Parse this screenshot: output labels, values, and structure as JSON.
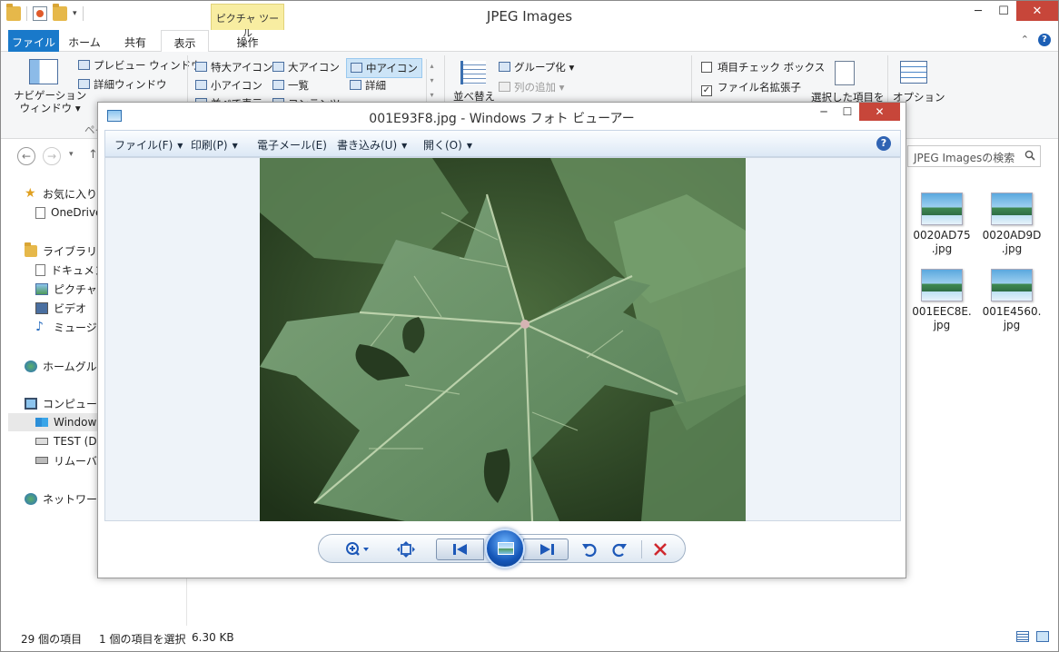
{
  "explorer": {
    "title": "JPEG Images",
    "context_tab_header": "ピクチャ ツール",
    "tabs": [
      "ファイル",
      "ホーム",
      "共有",
      "表示",
      "操作"
    ],
    "ribbon": {
      "nav_pane": "ナビゲーション\nウィンドウ ▾",
      "preview_pane": "プレビュー ウィンドウ",
      "details_pane": "詳細ウィンドウ",
      "pane_group_label": "ペイ",
      "layouts": [
        "特大アイコン",
        "大アイコン",
        "中アイコン",
        "小アイコン",
        "一覧",
        "詳細",
        "並べて表示",
        "コンテンツ"
      ],
      "sort_by": "並べ替え",
      "group_by": "グループ化",
      "add_columns": "列の追加",
      "item_checkboxes": "項目チェック ボックス",
      "file_extensions": "ファイル名拡張子",
      "hide_selected": "選択した項目を",
      "options": "オプション"
    },
    "search_placeholder": "JPEG Imagesの検索",
    "nav": {
      "favorites": "お気に入り",
      "onedrive": "OneDrive",
      "libraries": "ライブラリ",
      "documents": "ドキュメント",
      "pictures": "ピクチャ",
      "videos": "ビデオ",
      "music": "ミュージック",
      "homegroup": "ホームグループ",
      "computer": "コンピューター",
      "windows": "Windows",
      "test_drive": "TEST (D",
      "removable": "リムーバブル",
      "network": "ネットワーク"
    },
    "files": [
      {
        "line1": "0020AD75",
        "line2": ".jpg"
      },
      {
        "line1": "0020AD9D",
        "line2": ".jpg"
      },
      {
        "line1": "001EEC8E.",
        "line2": "jpg"
      },
      {
        "line1": "001E4560.",
        "line2": "jpg"
      }
    ],
    "status": {
      "item_count": "29 個の項目",
      "selected": "1 個の項目を選択",
      "size": "6.30 KB"
    }
  },
  "viewer": {
    "title": "001E93F8.jpg - Windows フォト ビューアー",
    "menus": [
      "ファイル(F)",
      "印刷(P)",
      "電子メール(E)",
      "書き込み(U)",
      "開く(O)"
    ],
    "help": "?"
  },
  "colors": {
    "accent_blue": "#1979ca",
    "close_red": "#c7463a",
    "context_tab_yellow": "#f8eda1"
  }
}
